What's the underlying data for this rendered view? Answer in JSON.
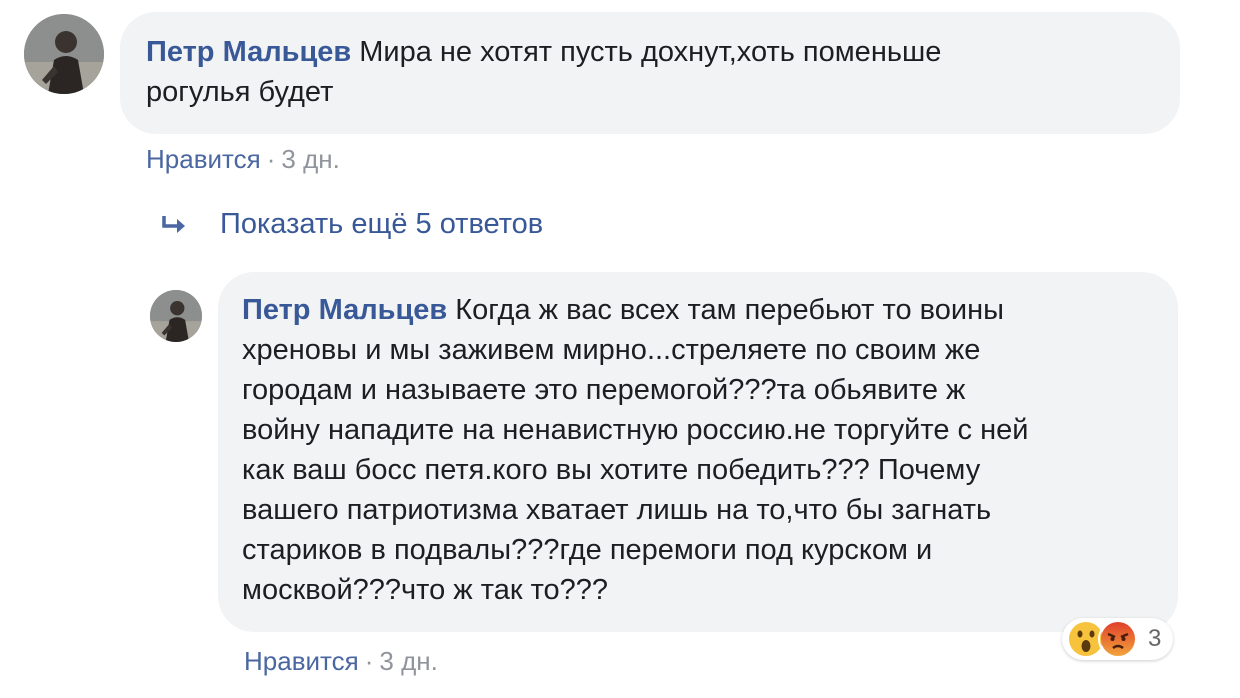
{
  "comments": [
    {
      "author": "Петр Мальцев",
      "text_lines": [
        "Мира не хотят пусть дохнут,хоть поменьше",
        "рогулья будет"
      ],
      "like_label": "Нравится",
      "separator": "·",
      "time": "3 дн."
    },
    {
      "author": "Петр Мальцев",
      "text_lines": [
        "Когда ж вас всех там перебьют то воины",
        "хреновы и мы заживем мирно...стреляете по своим же",
        "городам и называете это перемогой???та обьявите ж",
        "войну нападите на ненавистную россию.не торгуйте с ней",
        "как ваш босс петя.кого вы хотите победить??? Почему",
        "вашего патриотизма хватает лишь на то,что бы загнать",
        "стариков в подвалы???где перемоги под курском и",
        "москвой???что ж так то???"
      ],
      "like_label": "Нравится",
      "separator": "·",
      "time": "3 дн.",
      "reactions": {
        "icons": [
          "wow-reaction-icon",
          "angry-reaction-icon"
        ],
        "count": "3"
      }
    }
  ],
  "replies": {
    "label": "Показать ещё 5 ответов",
    "icon": "reply-arrow-icon"
  },
  "colors": {
    "author": "#385898",
    "bubble": "#f2f3f5",
    "meta": "#90949c"
  }
}
